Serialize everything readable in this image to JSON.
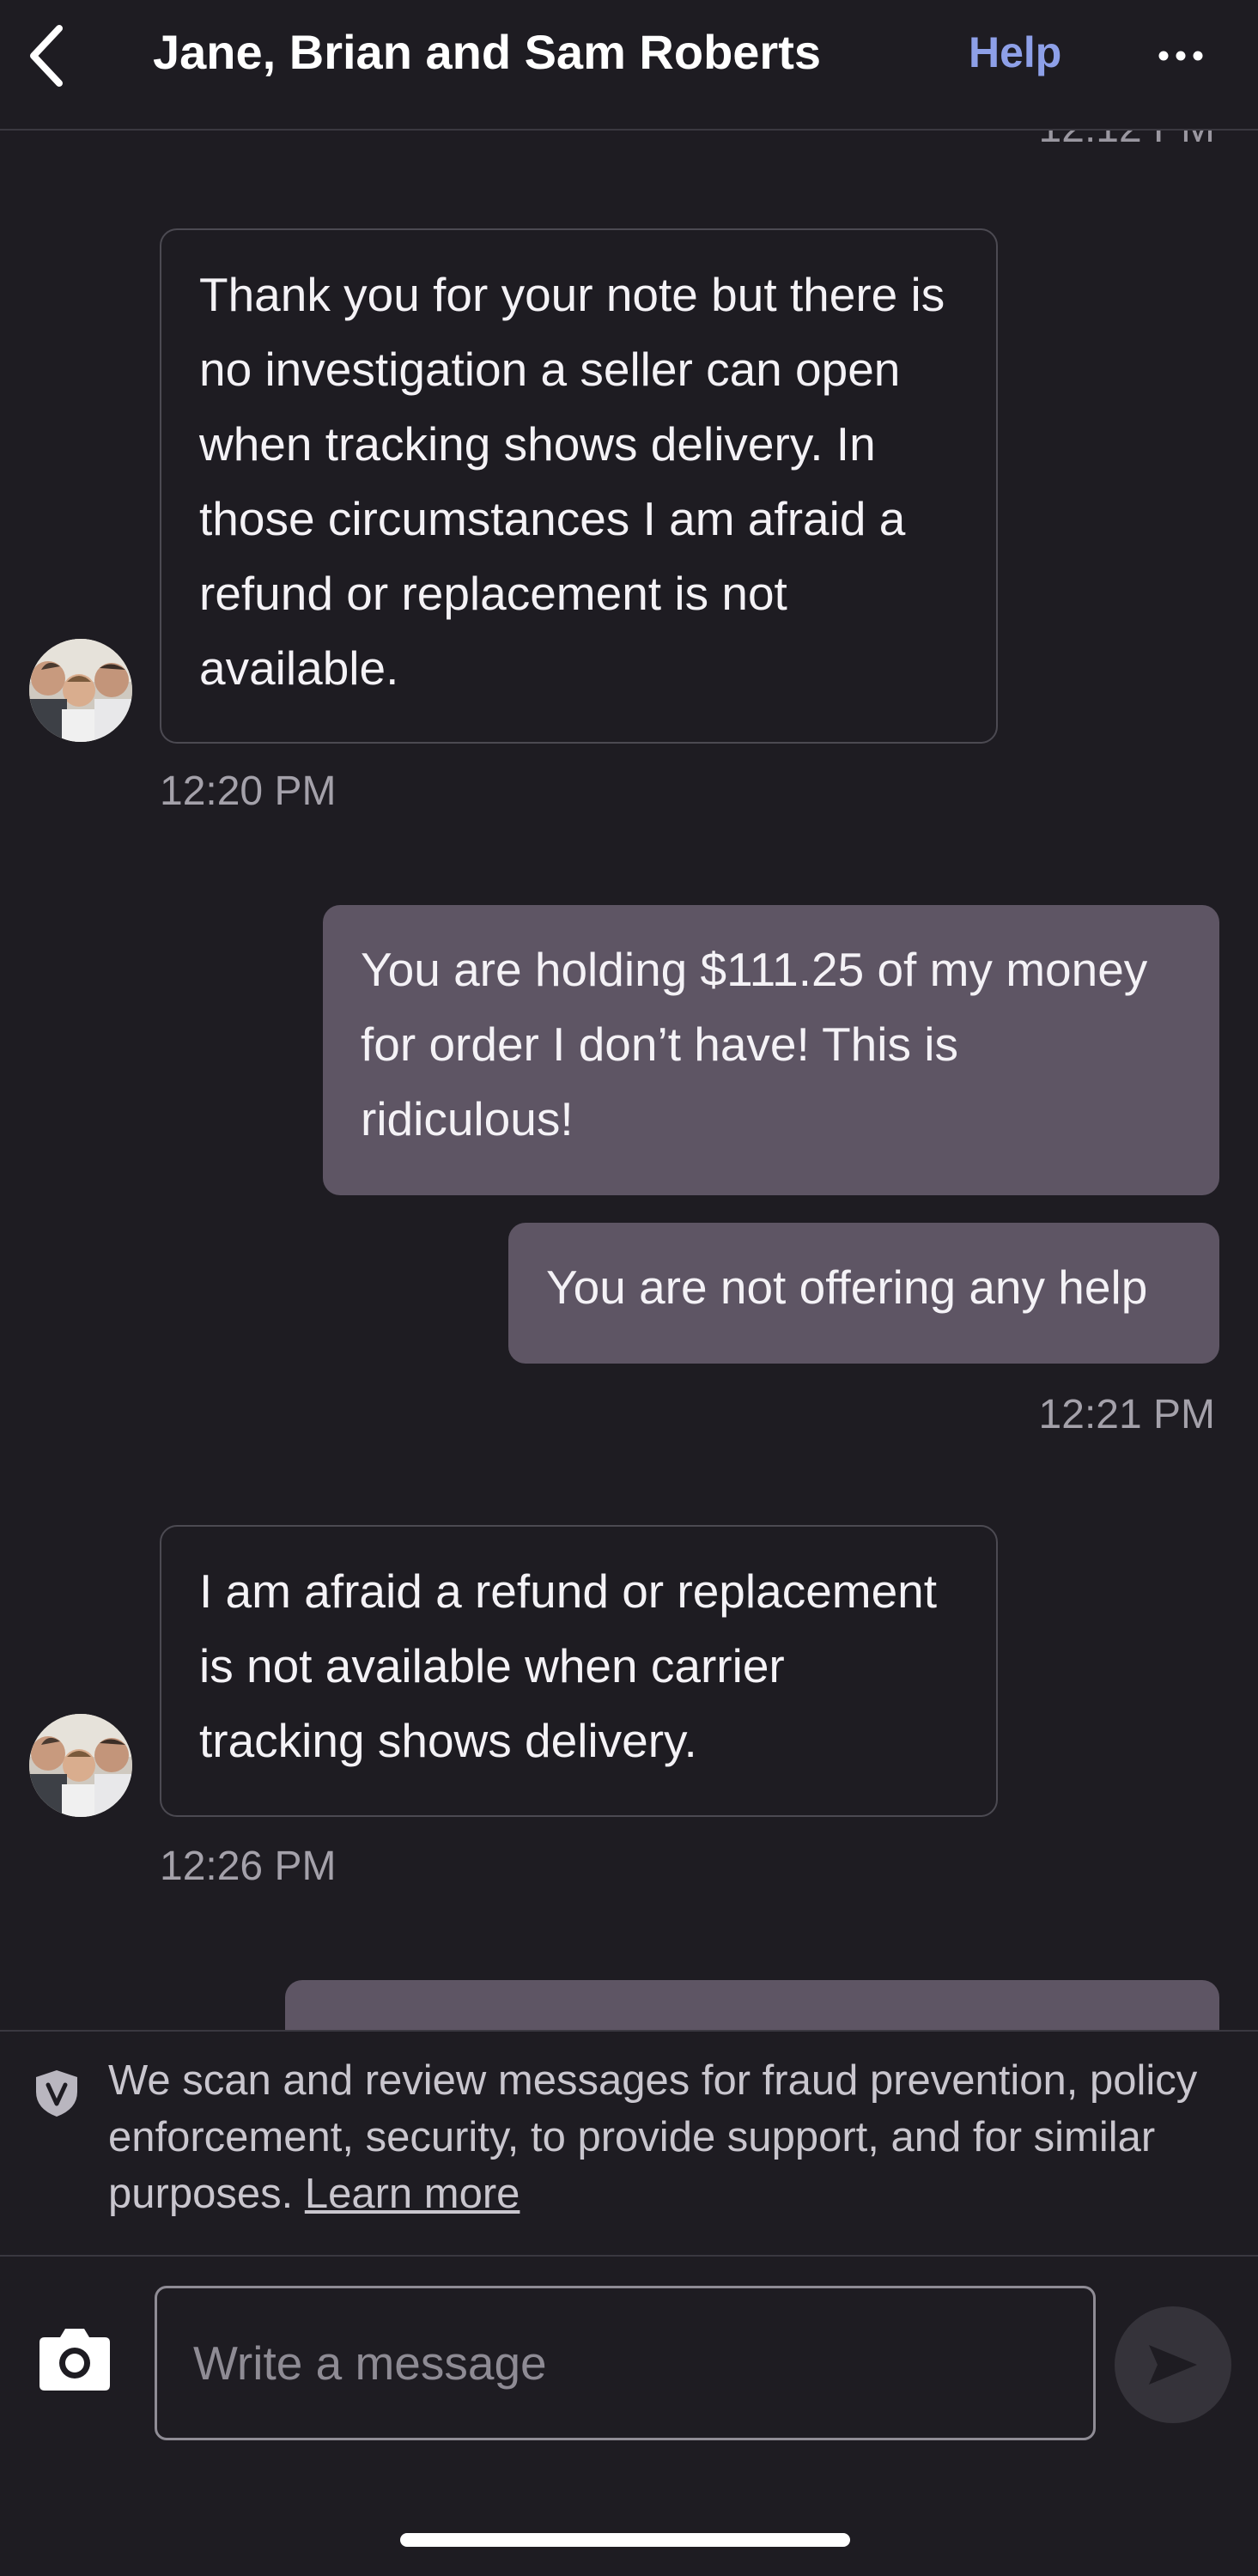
{
  "header": {
    "title": "Jane, Brian and Sam Roberts",
    "help_label": "Help",
    "back_icon": "chevron-left-icon",
    "more_icon": "ellipsis-icon"
  },
  "conversation": {
    "top_timestamp": "12:12 PM",
    "messages": [
      {
        "direction": "incoming",
        "text": "Thank you for your note but there is no investigation a seller can open when tracking shows delivery. In those circumstances I am afraid a refund or replacement is not available.",
        "timestamp": "12:20 PM"
      },
      {
        "direction": "outgoing",
        "text": "You are holding $111.25 of my money for order I don’t have! This is ridiculous!"
      },
      {
        "direction": "outgoing",
        "text": "You are not offering any help",
        "timestamp": "12:21 PM"
      },
      {
        "direction": "incoming",
        "text": "I am afraid a refund or replacement is not available when carrier tracking shows delivery.",
        "timestamp": "12:26 PM"
      }
    ]
  },
  "notice": {
    "text": "We scan and review messages for fraud prevention, policy enforcement, security, to provide support, and for similar purposes.",
    "link_label": "Learn more",
    "icon": "shield-v-icon"
  },
  "composer": {
    "placeholder": "Write a message",
    "value": "",
    "camera_icon": "camera-icon",
    "send_icon": "send-icon"
  },
  "colors": {
    "background": "#1e1c22",
    "outgoing_bubble": "#5e5564",
    "link": "#8ea0e8"
  }
}
